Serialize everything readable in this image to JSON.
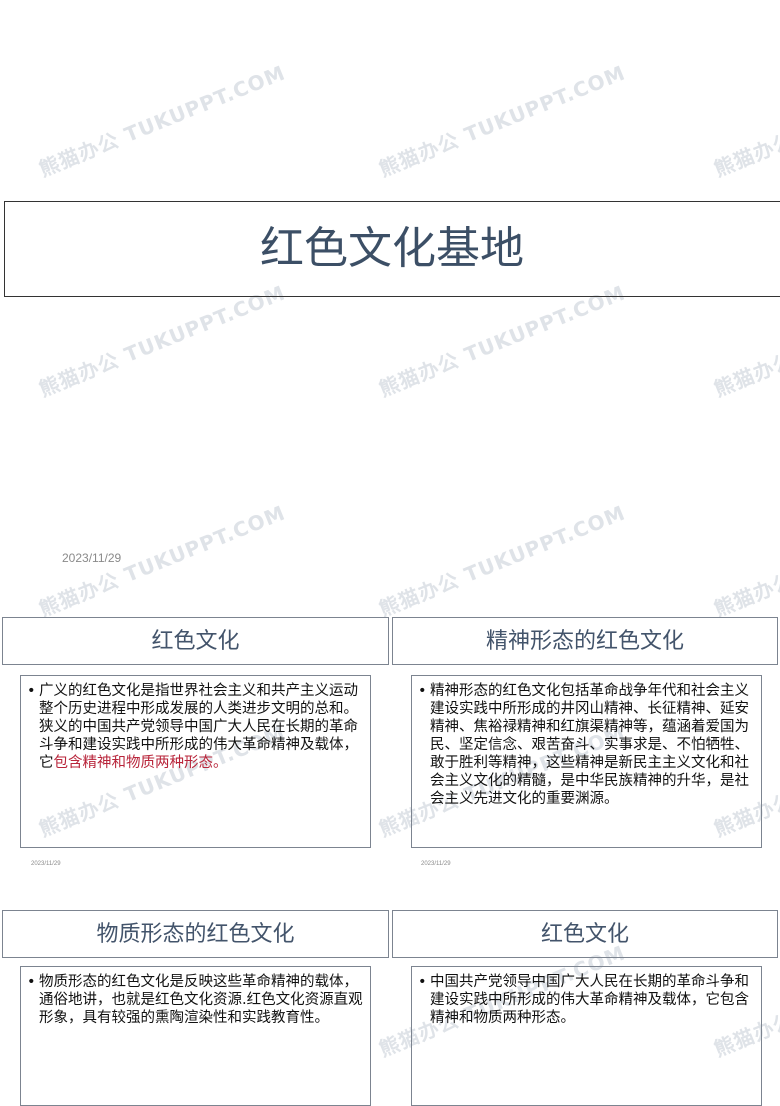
{
  "watermark": "熊猫办公 TUKUPPT.COM",
  "title_slide": {
    "title": "红色文化基地",
    "date": "2023/11/29"
  },
  "slides": [
    {
      "heading": "红色文化",
      "bullet": "•",
      "text_plain": "广义的红色文化是指世界社会主义和共产主义运动整个历史进程中形成发展的人类进步文明的总和。狭义的中国共产党领导中国广大人民在长期的革命斗争和建设实践中所形成的伟大革命精神及载体，它",
      "text_highlight": "包含精神和物质两种形态。",
      "date": "2023/11/29"
    },
    {
      "heading": "精神形态的红色文化",
      "bullet": "•",
      "text_plain": "精神形态的红色文化包括革命战争年代和社会主义建设实践中所形成的井冈山精神、长征精神、延安精神、焦裕禄精神和红旗渠精神等，蕴涵着爱国为民、坚定信念、艰苦奋斗、实事求是、不怕牺牲、敢于胜利等精神，这些精神是新民主主义文化和社会主义文化的精髓，是中华民族精神的升华，是社会主义先进文化的重要渊源。",
      "date": "2023/11/29"
    },
    {
      "heading": "物质形态的红色文化",
      "bullet": "•",
      "text_plain": "物质形态的红色文化是反映这些革命精神的载体，通俗地讲，也就是红色文化资源.红色文化资源直观形象，具有较强的熏陶渲染性和实践教育性。"
    },
    {
      "heading": "红色文化",
      "bullet": "•",
      "text_plain": "中国共产党领导中国广大人民在长期的革命斗争和建设实践中所形成的伟大革命精神及载体，它包含精神和物质两种形态。"
    }
  ]
}
